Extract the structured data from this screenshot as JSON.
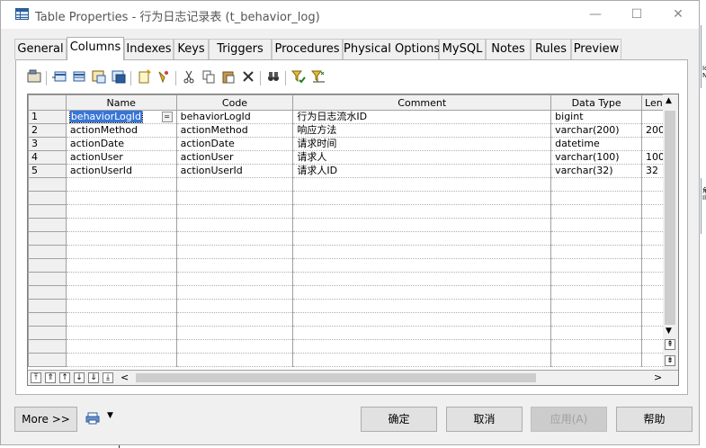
{
  "window": {
    "title": "Table Properties - 行为日志记录表 (t_behavior_log)",
    "minimize": "—",
    "maximize": "☐",
    "close": "✕"
  },
  "tabs": [
    "General",
    "Columns",
    "Indexes",
    "Keys",
    "Triggers",
    "Procedures",
    "Physical Options",
    "MySQL",
    "Notes",
    "Rules",
    "Preview"
  ],
  "active_tab": "Columns",
  "toolbar_icons": [
    "properties-icon",
    "add-row-icon",
    "insert-row-icon",
    "add-attribute-icon",
    "add-group-icon",
    "new-icon",
    "find-icon",
    "cut-icon",
    "copy-icon",
    "paste-icon",
    "delete-icon",
    "binoculars-icon",
    "filter-icon",
    "filter-options-icon"
  ],
  "grid": {
    "columns": [
      "Name",
      "Code",
      "Comment",
      "Data Type",
      "Len"
    ],
    "rows": [
      {
        "num": "1",
        "name": "behaviorLogId",
        "code": "behaviorLogId",
        "comment": "行为日志流水ID",
        "type": "bigint",
        "len": ""
      },
      {
        "num": "2",
        "name": "actionMethod",
        "code": "actionMethod",
        "comment": "响应方法",
        "type": "varchar(200)",
        "len": "200"
      },
      {
        "num": "3",
        "name": "actionDate",
        "code": "actionDate",
        "comment": "请求时间",
        "type": "datetime",
        "len": ""
      },
      {
        "num": "4",
        "name": "actionUser",
        "code": "actionUser",
        "comment": "请求人",
        "type": "varchar(100)",
        "len": "100"
      },
      {
        "num": "5",
        "name": "actionUserId",
        "code": "actionUserId",
        "comment": "请求人ID",
        "type": "varchar(32)",
        "len": "32"
      }
    ],
    "ellipsis": "="
  },
  "buttons": {
    "more": "More >>",
    "ok": "确定",
    "cancel": "取消",
    "apply": "应用(A)",
    "help": "帮助"
  },
  "side_text": [
    "Id",
    "Na",
    "角",
    "Il"
  ]
}
